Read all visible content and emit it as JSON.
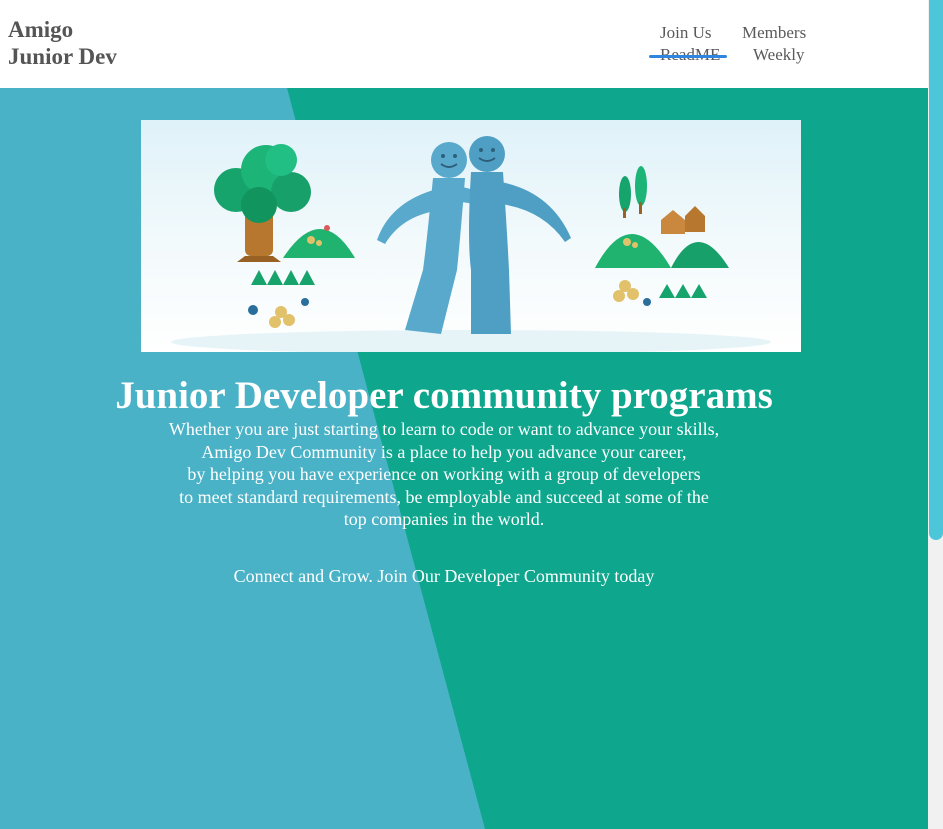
{
  "brand": {
    "line1": "Amigo",
    "line2": "Junior Dev"
  },
  "nav": {
    "join_us": "Join Us",
    "members": "Members",
    "readme": "ReadME",
    "weekly": "Weekly"
  },
  "hero": {
    "image": "clay-figures-friends-illustration"
  },
  "main": {
    "title": "Junior Developer community programs",
    "intro_lines": [
      "Whether you are just starting to learn to code or want to advance your skills,",
      "Amigo Dev Community is a place to help you advance your career,",
      "by helping you have experience on working with a group of developers",
      "to meet standard requirements, be employable and succeed at some of the",
      "top companies in the world."
    ],
    "cta": "Connect and Grow. Join Our Developer Community today"
  },
  "colors": {
    "teal": "#0ea68c",
    "blue": "#4ab2c6",
    "active_underline": "#2e86de",
    "header_bg": "#ffffff"
  }
}
